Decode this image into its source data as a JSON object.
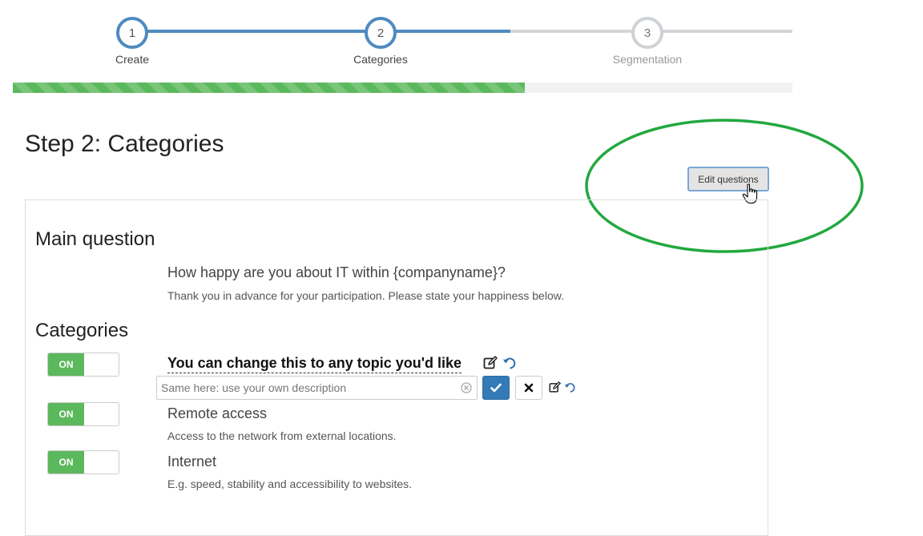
{
  "stepper": {
    "steps": [
      {
        "number": "1",
        "label": "Create",
        "state": "done"
      },
      {
        "number": "2",
        "label": "Categories",
        "state": "current"
      },
      {
        "number": "3",
        "label": "Segmentation",
        "state": "todo"
      }
    ],
    "progress_percent": 65.7,
    "colors": {
      "active": "#4e8ac0",
      "inactive": "#cfd2d5",
      "progress": "#5cb85c"
    }
  },
  "header": {
    "title": "Step 2: Categories",
    "edit_button_label": "Edit questions"
  },
  "main_question": {
    "section_title": "Main question",
    "question": "How happy are you about IT within {companyname}?",
    "description": "Thank you in advance for your participation. Please state your happiness below."
  },
  "categories": {
    "section_title": "Categories",
    "toggle_on_label": "ON",
    "items": [
      {
        "title": "You can change this to any topic you'd like",
        "editing": true,
        "edit_placeholder": "Same here: use your own description"
      },
      {
        "title": "Remote access",
        "description": "Access to the network from external locations."
      },
      {
        "title": "Internet",
        "description": "E.g. speed, stability and accessibility to websites."
      }
    ]
  },
  "annotation": {
    "color": "#22a83f"
  }
}
